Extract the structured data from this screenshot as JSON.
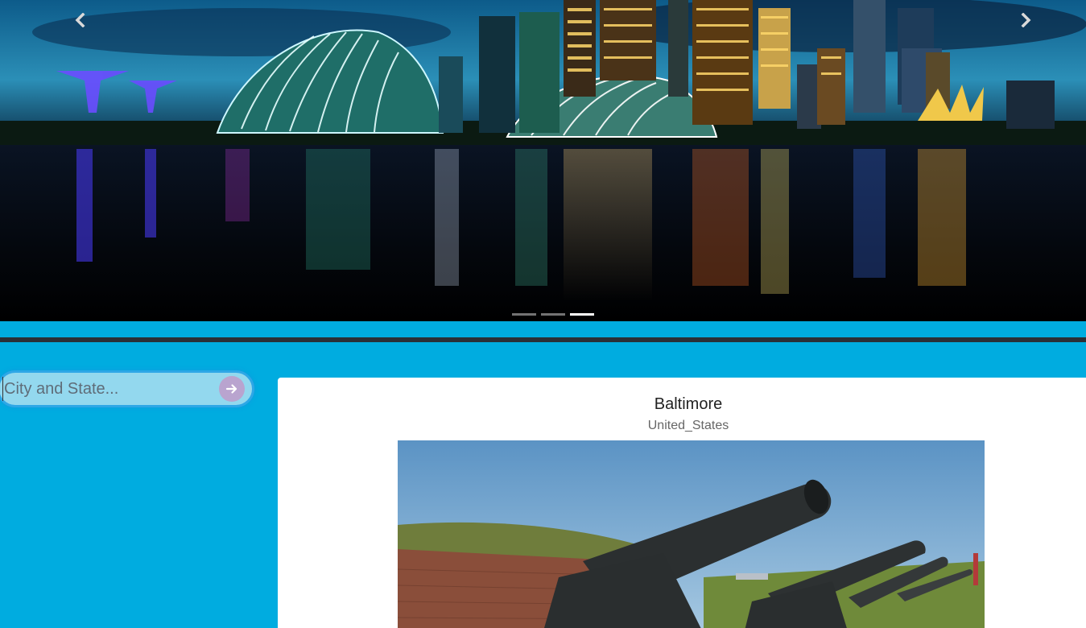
{
  "carousel": {
    "slide_count": 3,
    "active_slide": 3,
    "prev_icon": "chevron-left-icon",
    "next_icon": "chevron-right-icon"
  },
  "search": {
    "placeholder": "City and State...",
    "value": "",
    "submit_icon": "arrow-right-icon"
  },
  "result": {
    "city": "Baltimore",
    "country": "United_States"
  },
  "colors": {
    "page_background": "#00ace0",
    "divider": "#2a2f36",
    "search_fill": "#93d8ee",
    "search_border": "#2ea7e6",
    "search_button": "#b9a4cf",
    "card_background": "#ffffff"
  }
}
